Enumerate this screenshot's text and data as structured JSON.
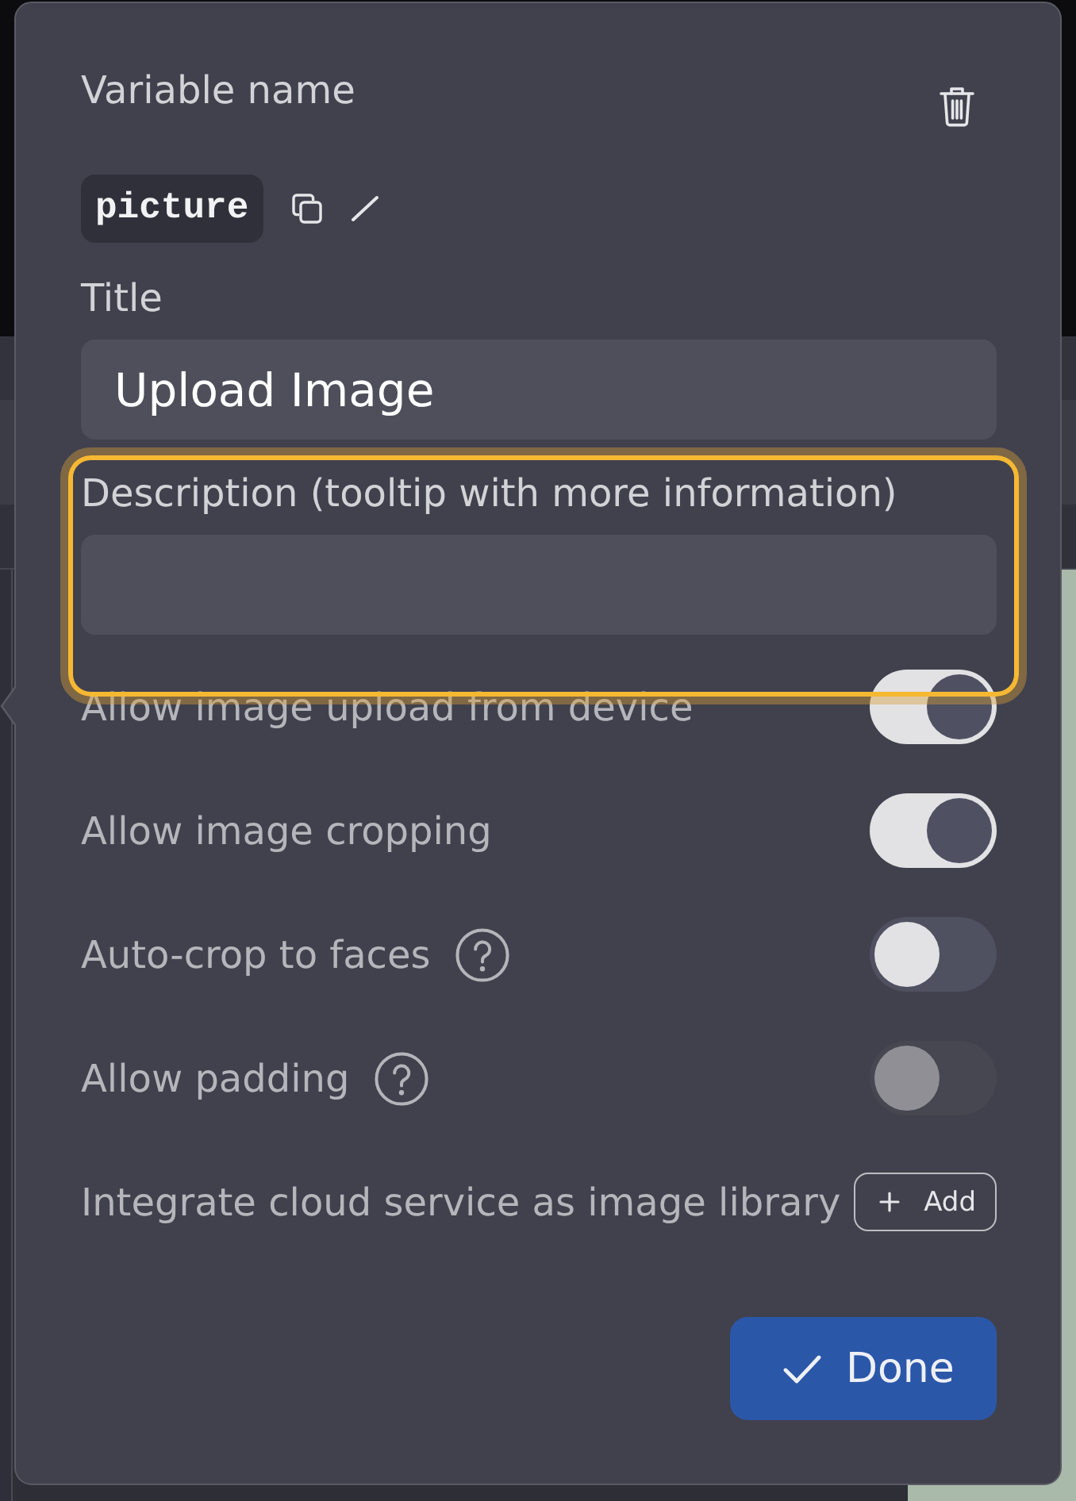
{
  "variable": {
    "label": "Variable name",
    "name": "picture"
  },
  "title_field": {
    "label": "Title",
    "value": "Upload Image"
  },
  "description_field": {
    "label": "Description (tooltip with more information)",
    "highlighted": true
  },
  "options": [
    {
      "kind": "toggle",
      "label": "Allow image upload from device",
      "checked": true,
      "disabled": false,
      "help": false
    },
    {
      "kind": "toggle",
      "label": "Allow image cropping",
      "checked": true,
      "disabled": false,
      "help": false
    },
    {
      "kind": "toggle",
      "label": "Auto-crop to faces",
      "checked": false,
      "disabled": false,
      "help": true
    },
    {
      "kind": "toggle",
      "label": "Allow padding",
      "checked": false,
      "disabled": true,
      "help": true
    },
    {
      "kind": "action",
      "label": "Integrate cloud service as image library",
      "button": "Add"
    }
  ],
  "done_button": {
    "label": "Done"
  }
}
